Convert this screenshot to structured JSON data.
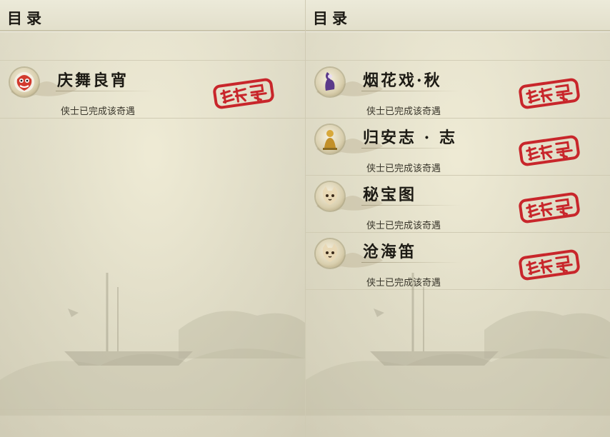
{
  "left": {
    "header": {
      "title": "目录"
    },
    "entries": [
      {
        "name": "庆舞良宵",
        "status": "侠士已完成该奇遇",
        "icon": "lion-dance-icon",
        "stamp": "completed-seal-icon"
      }
    ]
  },
  "right": {
    "header": {
      "title": "目录"
    },
    "entries": [
      {
        "name": "烟花戏·秋",
        "status": "侠士已完成该奇遇",
        "icon": "purple-figure-icon",
        "stamp": "completed-seal-icon"
      },
      {
        "name": "归安志 · 志",
        "status": "侠士已完成该奇遇",
        "icon": "golden-figure-icon",
        "stamp": "completed-seal-icon"
      },
      {
        "name": "秘宝图",
        "status": "侠士已完成该奇遇",
        "icon": "cat-icon",
        "stamp": "completed-seal-icon"
      },
      {
        "name": "沧海笛",
        "status": "侠士已完成该奇遇",
        "icon": "cat-icon",
        "stamp": "completed-seal-icon"
      }
    ]
  },
  "colors": {
    "stamp_red": "#c8262b",
    "text_dark": "#1c1a14",
    "paper": "#e4e1cf"
  }
}
